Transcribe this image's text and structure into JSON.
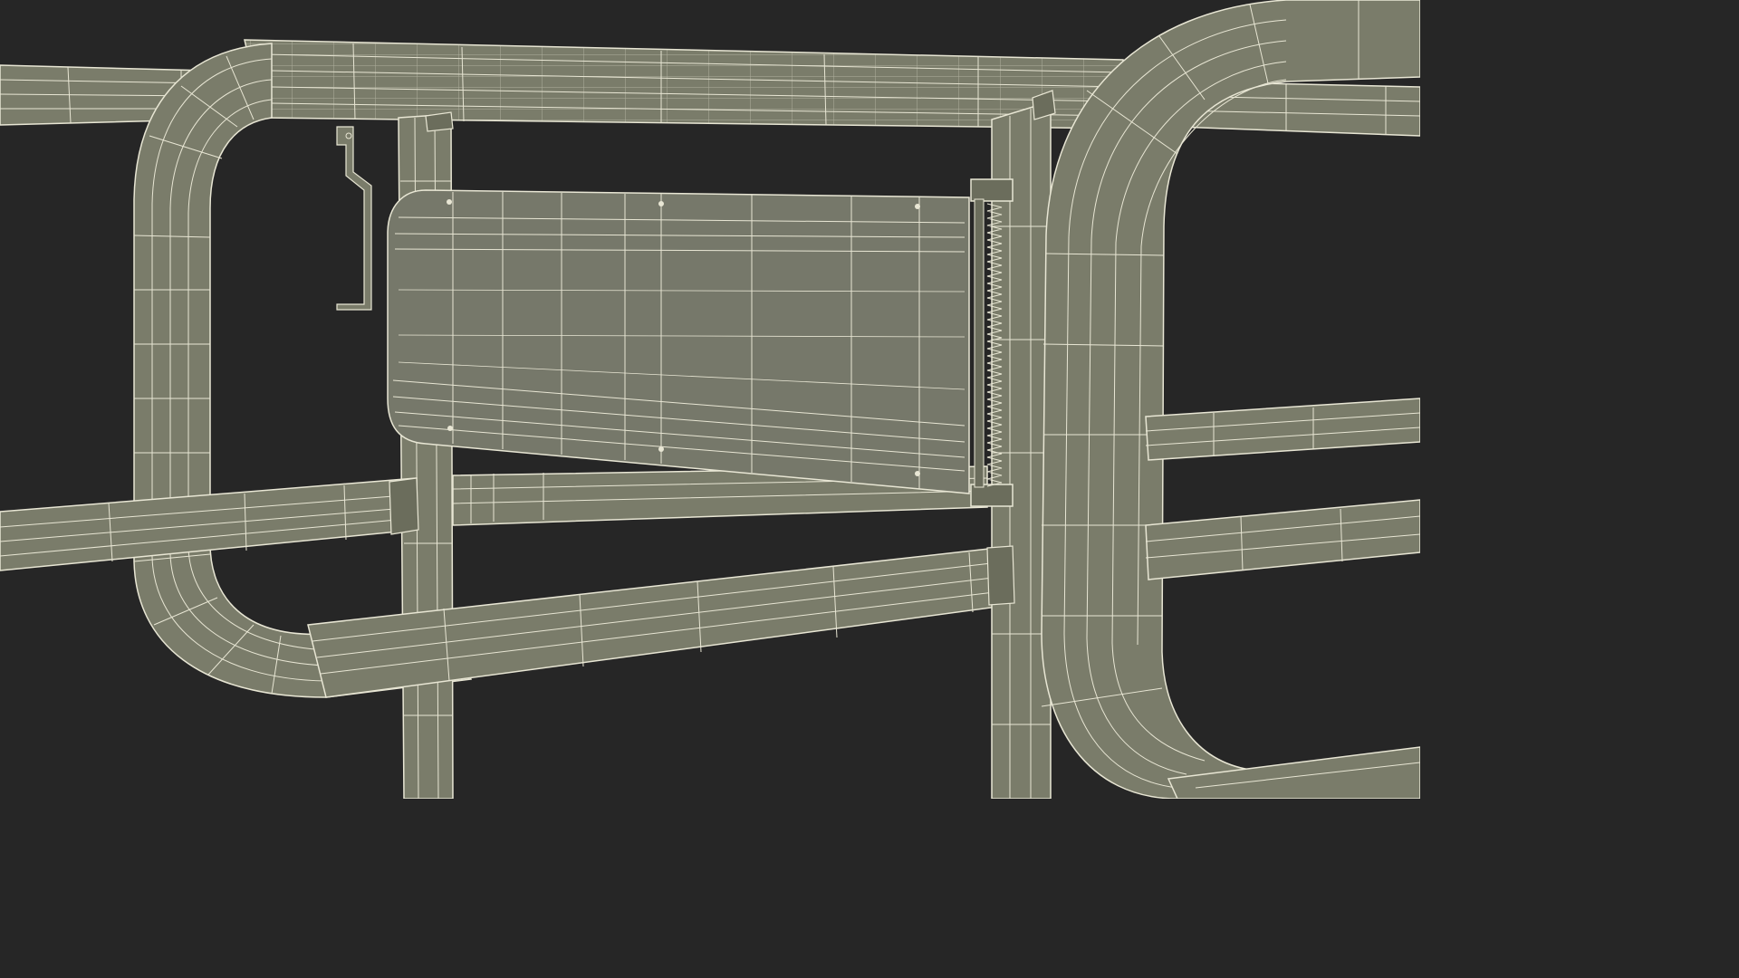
{
  "scene": {
    "subject": "",
    "colors": {
      "background": "#262626",
      "surface": "#7a7c6a",
      "surface_dark": "#6b6d5c",
      "surface_light": "#878a77",
      "wire": "#e8e6d4"
    }
  }
}
